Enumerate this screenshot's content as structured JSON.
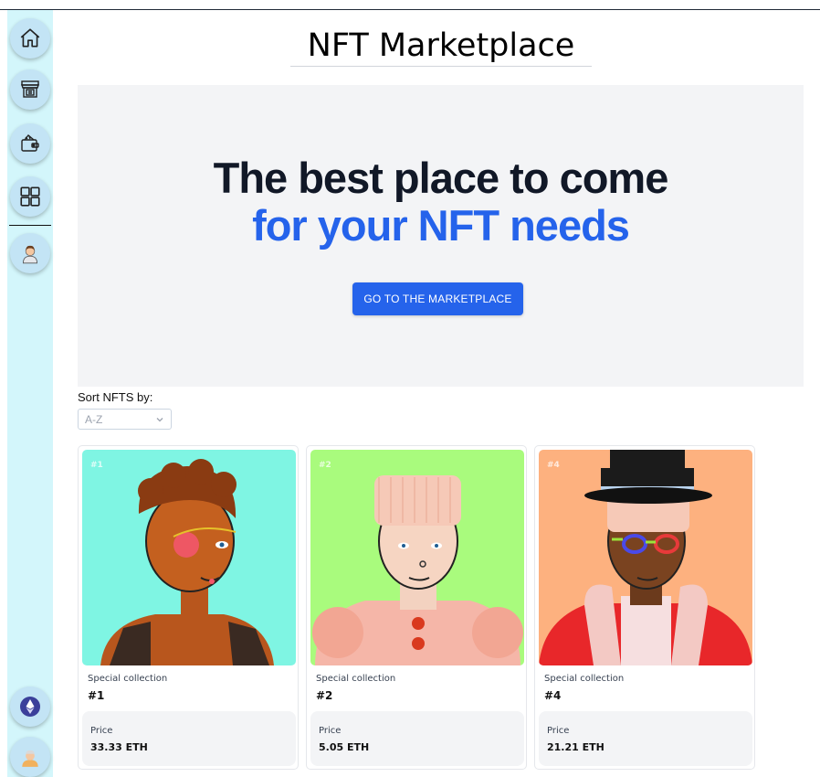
{
  "header": {
    "title": "NFT Marketplace"
  },
  "sidebar": {
    "items": [
      {
        "icon": "home-icon"
      },
      {
        "icon": "storefront-icon"
      },
      {
        "icon": "wallet-icon"
      },
      {
        "icon": "dashboard-icon"
      },
      {
        "icon": "user-avatar-icon"
      }
    ],
    "bottom": [
      {
        "icon": "ethereum-icon"
      },
      {
        "icon": "profile-avatar-icon"
      }
    ]
  },
  "hero": {
    "line1": "The best place to come",
    "line2": "for your NFT needs",
    "cta_label": "GO TO THE MARKETPLACE",
    "accent_color": "#2563eb"
  },
  "sort": {
    "label": "Sort NFTS by:",
    "selected": "A-Z"
  },
  "cards": [
    {
      "badge": "#1",
      "collection": "Special collection",
      "name": "#1",
      "price_label": "Price",
      "price": "33.33 ETH",
      "bg": "#7ff5e3"
    },
    {
      "badge": "#2",
      "collection": "Special collection",
      "name": "#2",
      "price_label": "Price",
      "price": "5.05 ETH",
      "bg": "#a9fb7d"
    },
    {
      "badge": "#4",
      "collection": "Special collection",
      "name": "#4",
      "price_label": "Price",
      "price": "21.21 ETH",
      "bg": "#fdb17f"
    }
  ]
}
